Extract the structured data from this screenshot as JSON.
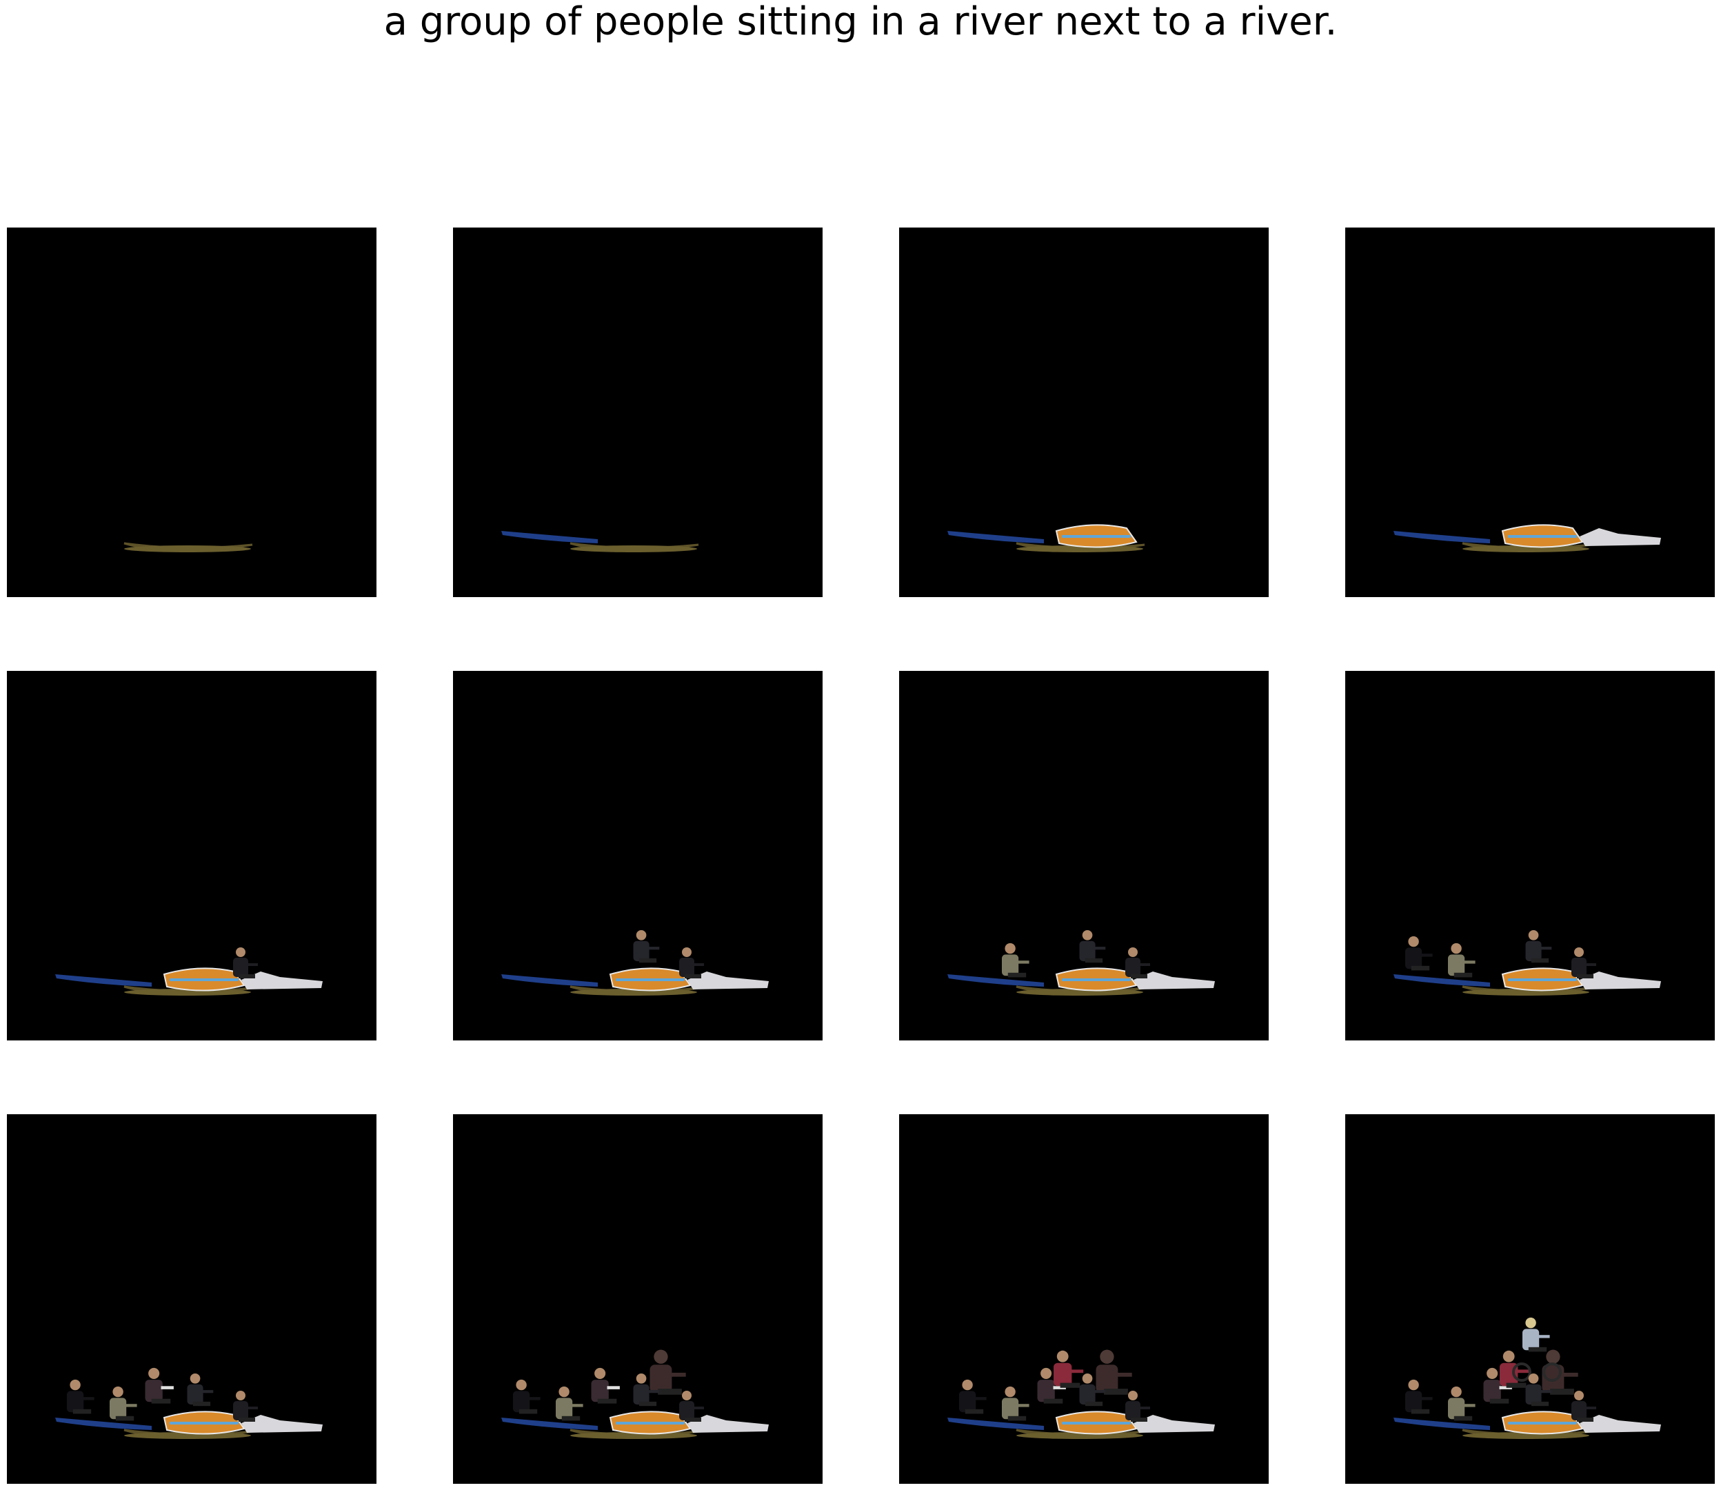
{
  "caption": "a group of people sitting in a river next to a river.",
  "frames": [
    {
      "step": 1,
      "objects": [
        "canoe-gold"
      ]
    },
    {
      "step": 2,
      "objects": [
        "canoe-gold",
        "kayak-blue"
      ]
    },
    {
      "step": 3,
      "objects": [
        "canoe-gold",
        "kayak-blue",
        "boat-orange"
      ]
    },
    {
      "step": 4,
      "objects": [
        "canoe-gold",
        "kayak-blue",
        "boat-orange",
        "boat-white"
      ]
    },
    {
      "step": 5,
      "objects": [
        "canoe-gold",
        "kayak-blue",
        "boat-orange",
        "boat-white",
        "person-dark-right"
      ]
    },
    {
      "step": 6,
      "objects": [
        "canoe-gold",
        "kayak-blue",
        "boat-orange",
        "boat-white",
        "person-dark-right",
        "person-dark-center"
      ]
    },
    {
      "step": 7,
      "objects": [
        "canoe-gold",
        "kayak-blue",
        "boat-orange",
        "boat-white",
        "person-dark-right",
        "person-dark-center",
        "person-khaki"
      ]
    },
    {
      "step": 8,
      "objects": [
        "canoe-gold",
        "kayak-blue",
        "boat-orange",
        "boat-white",
        "person-dark-right",
        "person-dark-center",
        "person-khaki",
        "person-black-left"
      ]
    },
    {
      "step": 9,
      "objects": [
        "canoe-gold",
        "kayak-blue",
        "boat-orange",
        "boat-white",
        "person-dark-right",
        "person-dark-center",
        "person-khaki",
        "person-black-left",
        "person-striped"
      ]
    },
    {
      "step": 10,
      "objects": [
        "canoe-gold",
        "kayak-blue",
        "boat-orange",
        "boat-white",
        "person-dark-right",
        "person-dark-center",
        "person-khaki",
        "person-black-left",
        "person-striped",
        "person-brown-large"
      ]
    },
    {
      "step": 11,
      "objects": [
        "canoe-gold",
        "kayak-blue",
        "boat-orange",
        "boat-white",
        "person-dark-right",
        "person-dark-center",
        "person-khaki",
        "person-black-left",
        "person-striped",
        "person-brown-large",
        "person-red"
      ]
    },
    {
      "step": 12,
      "objects": [
        "canoe-gold",
        "kayak-blue",
        "boat-orange",
        "boat-white",
        "person-dark-right",
        "person-dark-center",
        "person-khaki",
        "person-black-left",
        "person-striped",
        "person-brown-large",
        "person-red",
        "person-cyclist"
      ]
    }
  ],
  "colors": {
    "background": "#ffffff",
    "frame": "#000000",
    "canoe": "#8a7a3c",
    "kayak": "#1f3f8a",
    "boat_orange": "#d98a2b",
    "boat_white": "#d8d8dc",
    "skin": "#b08a6a"
  }
}
